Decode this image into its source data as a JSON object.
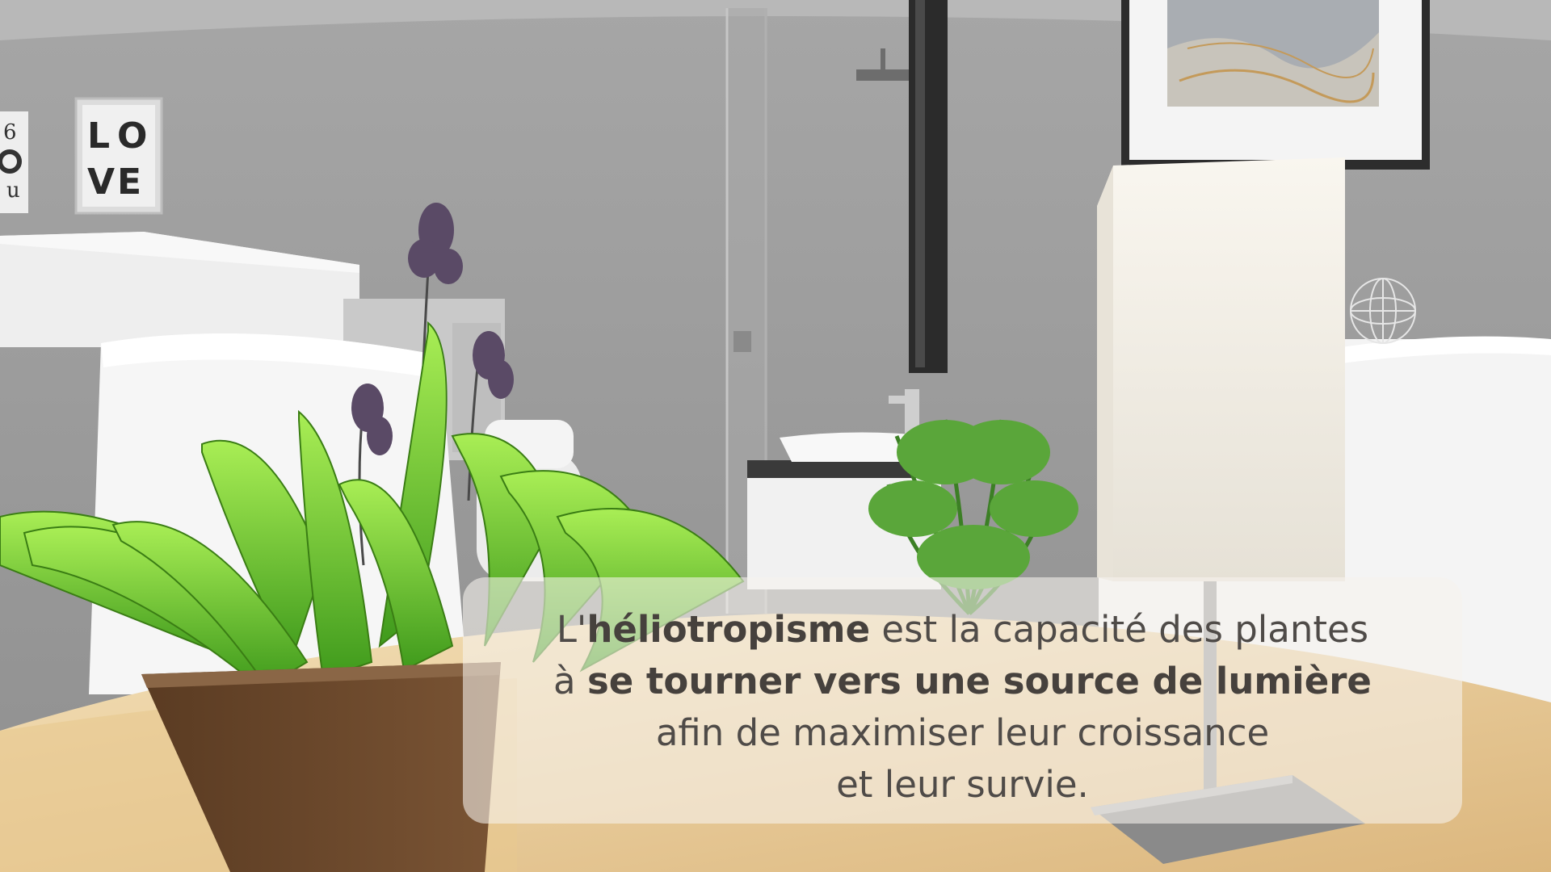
{
  "scene": {
    "description_icons": [
      "love-poster",
      "abstract-art-frame",
      "lamp",
      "potted-plant",
      "fern",
      "sink",
      "wire-sphere"
    ],
    "poster_letters": [
      "L",
      "O",
      "V",
      "E"
    ],
    "left_poster_fragment": [
      "6",
      "u"
    ]
  },
  "caption": {
    "line1_prefix": "L'",
    "line1_bold": "héliotropisme",
    "line1_suffix": " est la capacité des plantes",
    "line2_prefix": "à ",
    "line2_bold": "se tourner vers une source de lumière",
    "line3": "afin de maximiser leur croissance",
    "line4": "et leur survie."
  },
  "colors": {
    "wall": "#9c9c9c",
    "caption_box": "#f6f3ee",
    "caption_text": "#4f4b48",
    "leaf": "#7fd23a",
    "table_wood": "#e9cf9e"
  }
}
